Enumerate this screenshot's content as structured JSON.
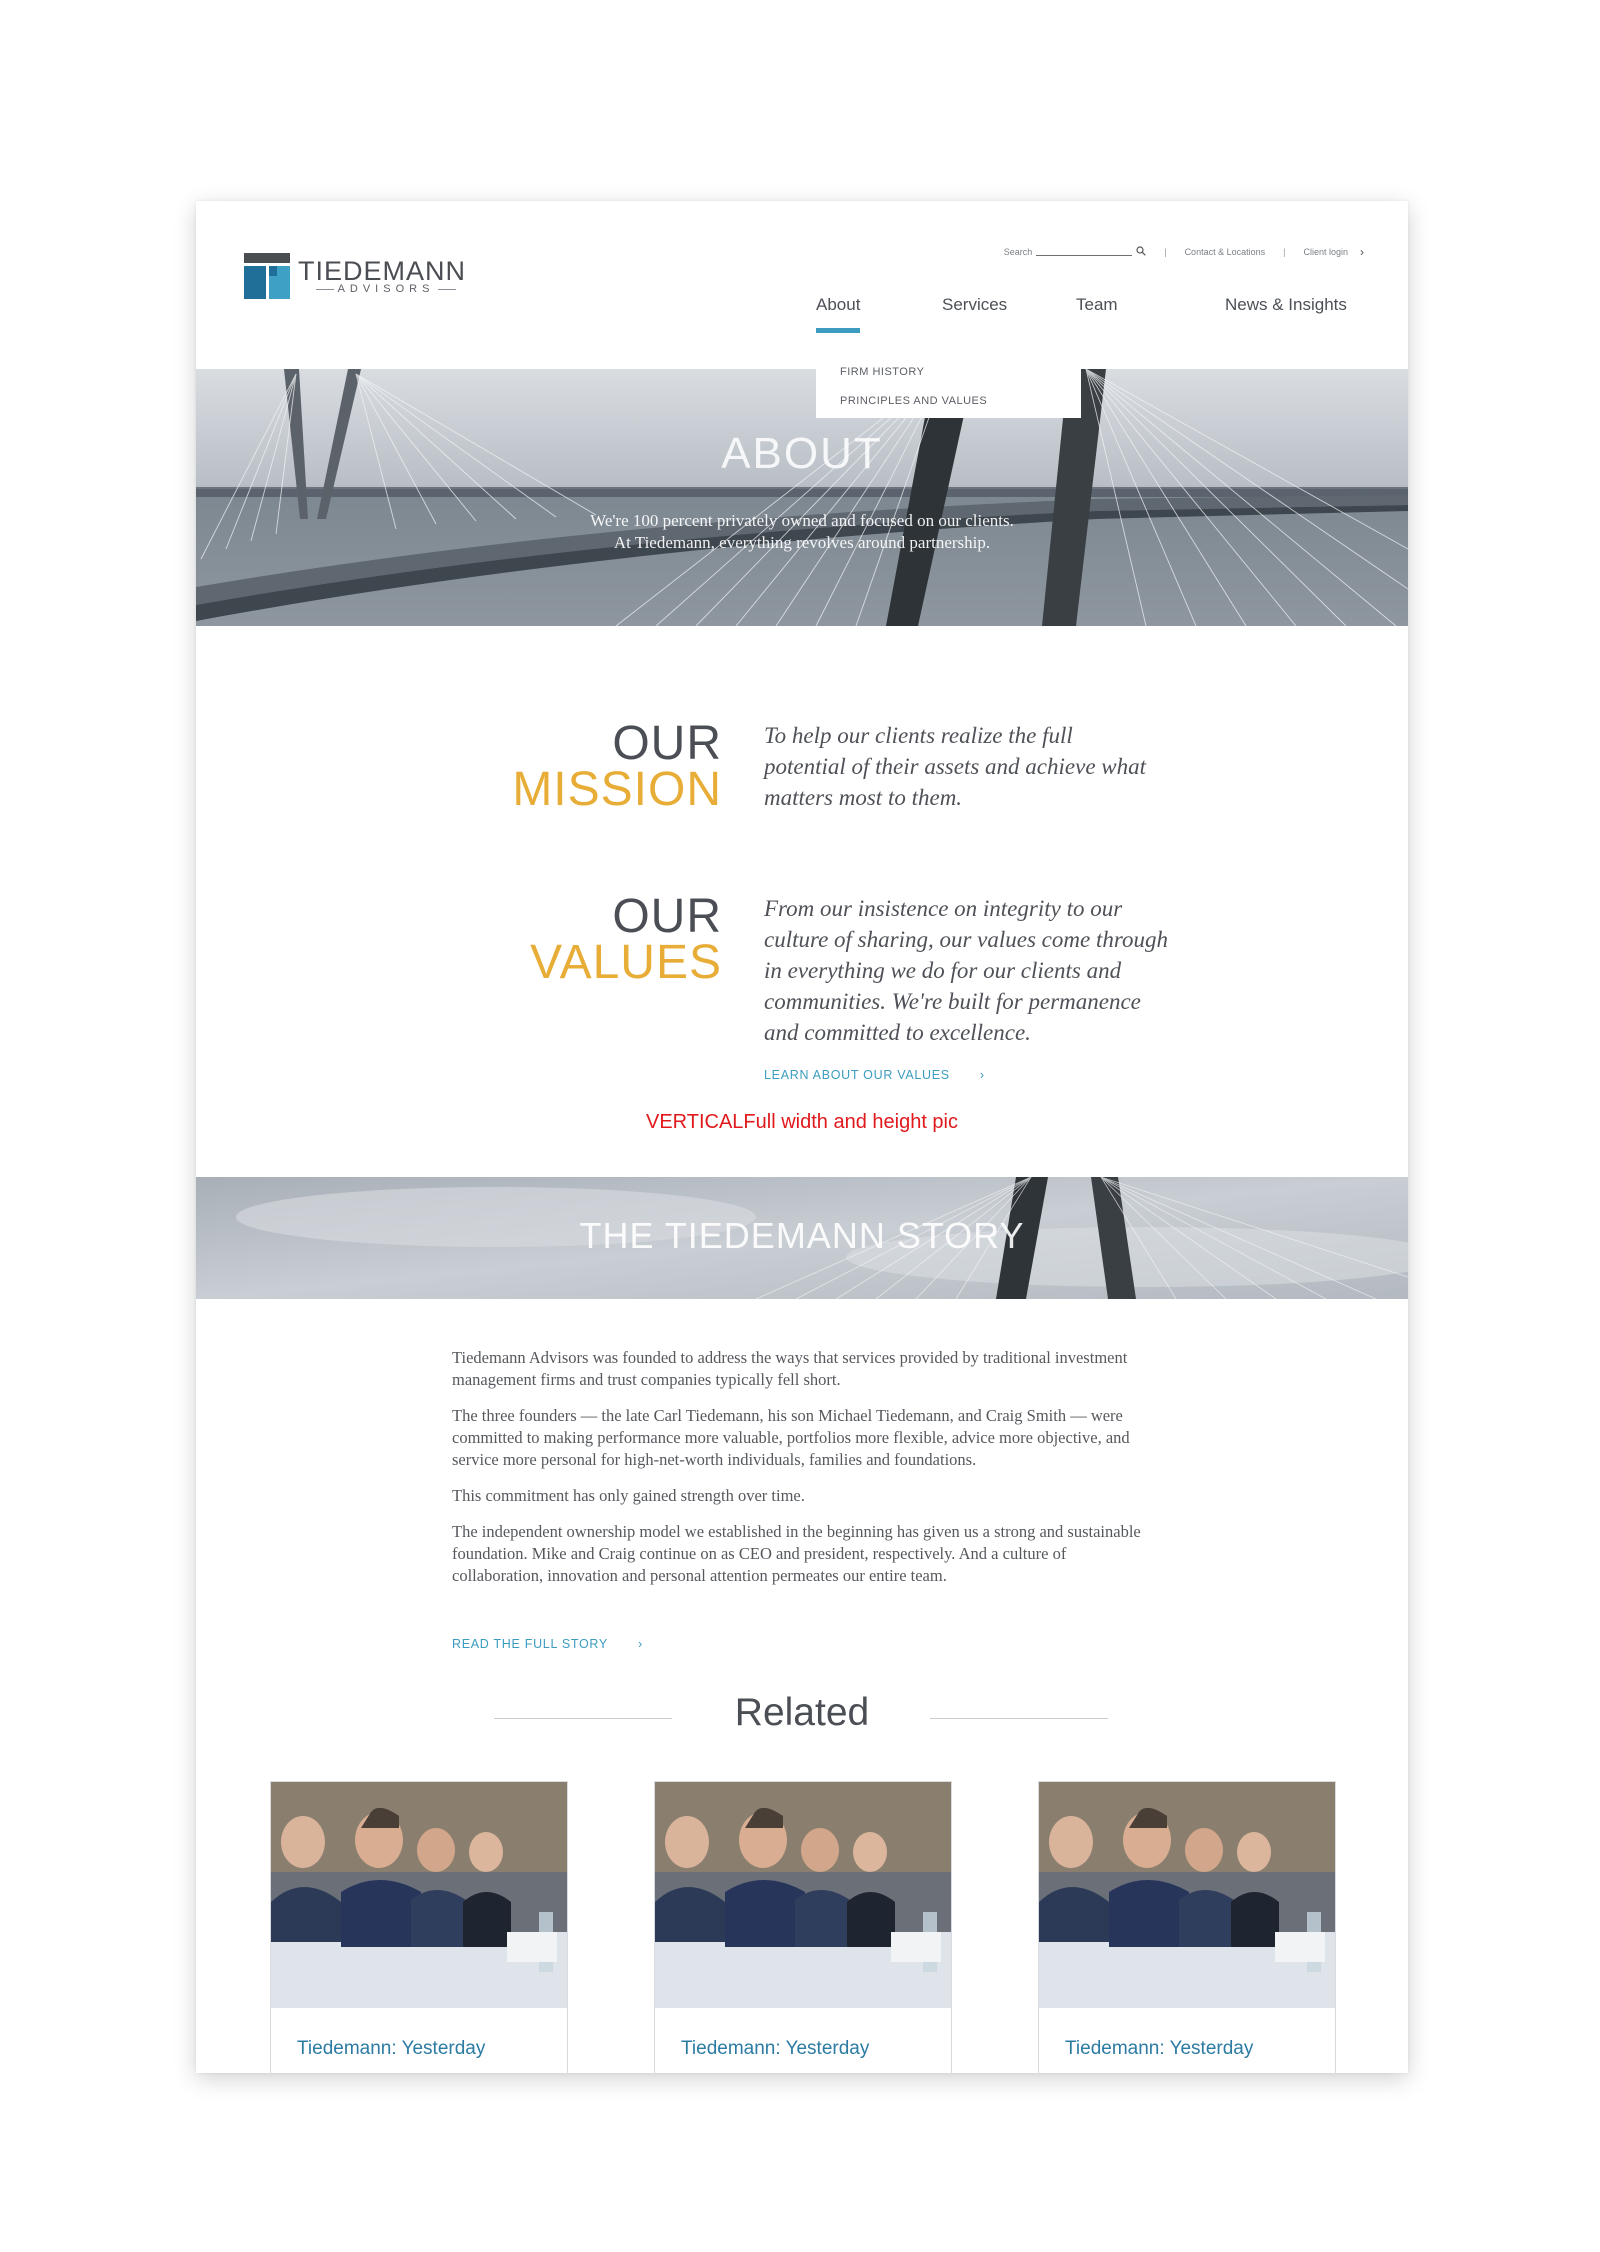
{
  "brand": {
    "name": "TIEDEMANN",
    "tagline": "ADVISORS"
  },
  "utility": {
    "search_label": "Search",
    "contact_label": "Contact & Locations",
    "login_label": "Client login",
    "separator": "|"
  },
  "nav": {
    "about": "About",
    "services": "Services",
    "team": "Team",
    "news": "News & Insights",
    "active": "About"
  },
  "dropdown": {
    "items": [
      "FIRM HISTORY",
      "PRINCIPLES AND VALUES"
    ]
  },
  "hero": {
    "title": "ABOUT",
    "line1": "We're 100 percent privately owned and focused on our clients.",
    "line2": "At Tiedemann, everything revolves around partnership."
  },
  "mission": {
    "word1": "OUR",
    "word2": "MISSION",
    "text_lines": [
      "To help our clients realize the full",
      "potential of their assets and achieve what",
      "matters most to them."
    ]
  },
  "values": {
    "word1": "OUR",
    "word2": "VALUES",
    "text_lines": [
      "From our insistence on integrity to our",
      "culture of sharing, our values come through",
      "in everything we do for our clients and",
      "communities. We're built for permanence",
      "and committed to excellence."
    ],
    "cta": "LEARN ABOUT OUR VALUES"
  },
  "annotation": "VERTICALFull width and height pic",
  "story": {
    "title": "THE TIEDEMANN STORY",
    "paragraphs": [
      "Tiedemann Advisors was founded to address the ways that services provided by traditional investment management firms and trust companies typically fell short.",
      "The three founders — the late Carl Tiedemann, his son Michael Tiedemann, and Craig Smith — were committed to making performance more valuable, portfolios more flexible, advice more objective, and service more personal for high-net-worth individuals, families and foundations.",
      "This commitment has only gained strength over time.",
      "The independent ownership model we established in the beginning has given us a strong and sustainable foundation. Mike and Craig continue on as CEO and president, respectively. And a culture of collaboration, innovation and personal attention permeates our entire team."
    ],
    "cta": "READ THE FULL STORY"
  },
  "related": {
    "title": "Related",
    "cards": [
      {
        "title": "Tiedemann: Yesterday"
      },
      {
        "title": "Tiedemann: Yesterday"
      },
      {
        "title": "Tiedemann: Yesterday"
      }
    ]
  },
  "colors": {
    "accent_blue": "#3b9cbf",
    "gold": "#e8ad37",
    "text_dark": "#4b4f55",
    "annotation_red": "#e0191c"
  }
}
